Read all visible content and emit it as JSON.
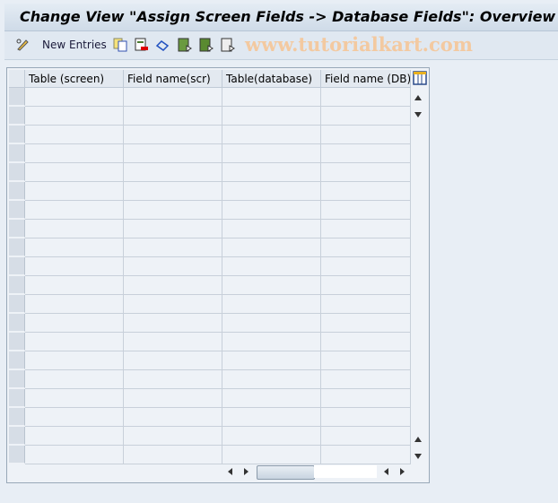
{
  "title": "Change View \"Assign Screen Fields -> Database Fields\": Overview",
  "toolbar": {
    "new_entries": "New Entries",
    "icons": [
      "edit-glasses-icon",
      "copy-icon",
      "delete-icon",
      "undo-icon",
      "select-all-icon",
      "select-block-icon",
      "deselect-all-icon"
    ]
  },
  "watermark": "www.tutorialkart.com",
  "table": {
    "columns": [
      "Table (screen)",
      "Field name(scr)",
      "Table(database)",
      "Field name (DB)"
    ],
    "row_count": 20
  }
}
